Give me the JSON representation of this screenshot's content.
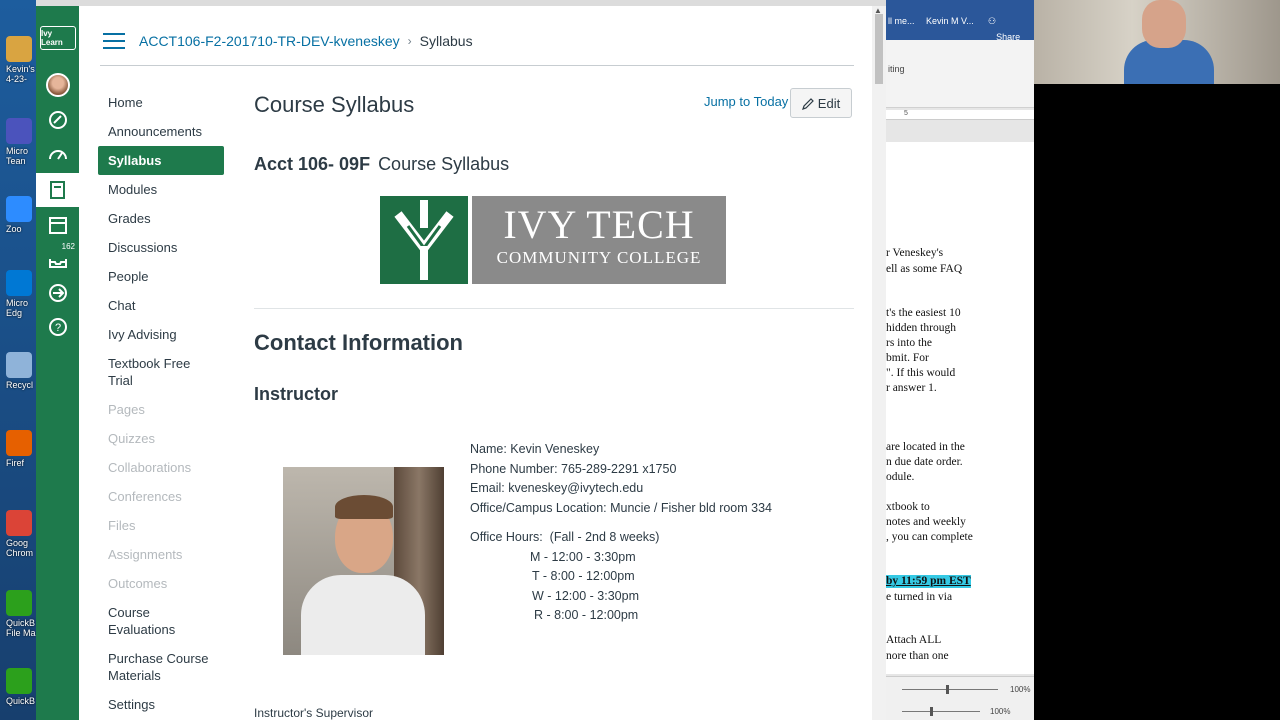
{
  "desktop": {
    "icons": [
      {
        "name": "kevins-file",
        "label": "Kevin's\n4-23-",
        "color": "#d9a441"
      },
      {
        "name": "teams",
        "label": "Micro\nTean",
        "color": "#4b53bc"
      },
      {
        "name": "zoom",
        "label": "Zoo",
        "color": "#2d8cff"
      },
      {
        "name": "edge",
        "label": "Micro\nEdg",
        "color": "#0078d4"
      },
      {
        "name": "recycle",
        "label": "Recycl",
        "color": "#8fb3d9"
      },
      {
        "name": "firefox",
        "label": "Firef",
        "color": "#e66000"
      },
      {
        "name": "chrome",
        "label": "Goog\nChrom",
        "color": "#db4437"
      },
      {
        "name": "quickbooks-file",
        "label": "QuickB\nFile Ma",
        "color": "#2ca01c"
      },
      {
        "name": "quickbooks",
        "label": "QuickB",
        "color": "#2ca01c"
      }
    ]
  },
  "global_nav": {
    "logo": "Ivy Learn",
    "badge": "162"
  },
  "breadcrumb": {
    "course": "ACCT106-F2-201710-TR-DEV-kveneskey",
    "separator": "›",
    "current": "Syllabus"
  },
  "course_nav": [
    {
      "label": "Home",
      "state": "normal"
    },
    {
      "label": "Announcements",
      "state": "normal"
    },
    {
      "label": "Syllabus",
      "state": "active"
    },
    {
      "label": "Modules",
      "state": "normal"
    },
    {
      "label": "Grades",
      "state": "normal"
    },
    {
      "label": "Discussions",
      "state": "normal"
    },
    {
      "label": "People",
      "state": "normal"
    },
    {
      "label": "Chat",
      "state": "normal"
    },
    {
      "label": "Ivy Advising",
      "state": "normal"
    },
    {
      "label": "Textbook Free Trial",
      "state": "normal"
    },
    {
      "label": "Pages",
      "state": "dim"
    },
    {
      "label": "Quizzes",
      "state": "dim"
    },
    {
      "label": "Collaborations",
      "state": "dim"
    },
    {
      "label": "Conferences",
      "state": "dim"
    },
    {
      "label": "Files",
      "state": "dim"
    },
    {
      "label": "Assignments",
      "state": "dim"
    },
    {
      "label": "Outcomes",
      "state": "dim"
    },
    {
      "label": "Course Evaluations",
      "state": "normal"
    },
    {
      "label": "Purchase Course Materials",
      "state": "normal"
    },
    {
      "label": "Settings",
      "state": "normal"
    }
  ],
  "main": {
    "title": "Course Syllabus",
    "jump_today": "Jump to Today",
    "edit": "Edit",
    "course_code": "Acct 106- 09F",
    "course_subtitle": "Course Syllabus",
    "logo_line1": "IVY TECH",
    "logo_line2": "COMMUNITY COLLEGE",
    "contact_heading": "Contact Information",
    "instructor_heading": "Instructor",
    "details": {
      "name": "Name: Kevin Veneskey",
      "phone": "Phone Number: 765-289-2291 x1750",
      "email": "Email: kveneskey@ivytech.edu",
      "location": "Office/Campus Location: Muncie / Fisher bld room 334"
    },
    "office_hours": {
      "label": "Office Hours:",
      "term": "(Fall - 2nd 8 weeks)",
      "rows": [
        "M - 12:00 - 3:30pm",
        "T -  8:00 - 12:00pm",
        "W -  12:00 - 3:30pm",
        "R -  8:00 - 12:00pm"
      ]
    },
    "supervisor": "Instructor's Supervisor"
  },
  "word": {
    "title_left": "ll me...",
    "title_user": "Kevin M V...",
    "share": "Share",
    "ribbon_text": "iting",
    "ruler": "5",
    "lines": [
      "r Veneskey's",
      "ell as some FAQ",
      "t's the easiest 10",
      "hidden through",
      "rs into the",
      "bmit.  For",
      "\".  If this would",
      "r answer 1.",
      "are located in the",
      "n due date order.",
      "odule.",
      "xtbook to",
      "notes and weekly",
      ", you can complete",
      "by 11:59 pm EST",
      "e turned in via",
      "Attach ALL",
      "nore than one"
    ],
    "zoom": [
      "100%",
      "100%"
    ]
  }
}
